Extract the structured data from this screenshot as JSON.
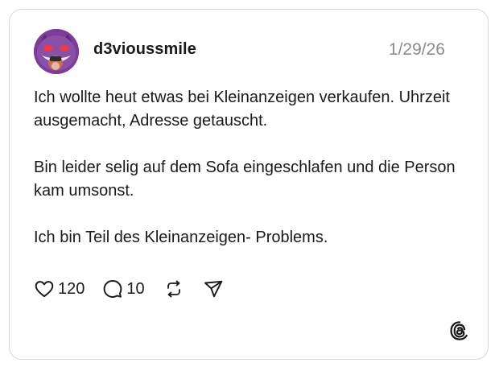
{
  "post": {
    "username": "d3vioussmile",
    "date": "1/29/26",
    "paragraphs": [
      "Ich wollte heut etwas bei Kleinanzeigen verkaufen. Uhrzeit ausgemacht, Adresse getauscht.",
      "Bin leider selig auf dem Sofa eingeschlafen und die Person kam umsonst.",
      "Ich bin Teil des Kleinanzeigen- Problems."
    ],
    "actions": {
      "like_icon": "heart-icon",
      "like_count": "120",
      "reply_icon": "speech-bubble-icon",
      "reply_count": "10",
      "repost_icon": "repost-icon",
      "share_icon": "send-icon"
    },
    "brand_icon": "threads-logo-icon"
  },
  "colors": {
    "text": "#1a1a1a",
    "muted": "#8c8c8c",
    "border": "#d9d9d9",
    "avatar_bg": "#8a4fa6"
  }
}
